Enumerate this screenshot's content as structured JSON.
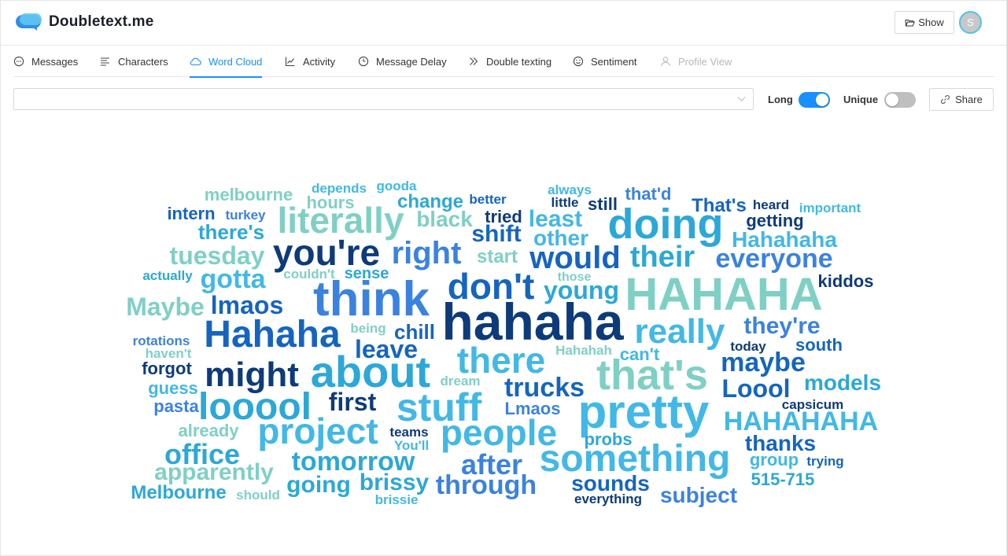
{
  "app": {
    "title": "Doubletext.me"
  },
  "header": {
    "show_label": "Show",
    "avatar_initial": "S"
  },
  "tabs": [
    {
      "label": "Messages",
      "icon": "message-circle-icon",
      "state": "normal"
    },
    {
      "label": "Characters",
      "icon": "text-align-left-icon",
      "state": "normal"
    },
    {
      "label": "Word Cloud",
      "icon": "cloud-icon",
      "state": "active"
    },
    {
      "label": "Activity",
      "icon": "line-chart-icon",
      "state": "normal"
    },
    {
      "label": "Message Delay",
      "icon": "clock-icon",
      "state": "normal"
    },
    {
      "label": "Double texting",
      "icon": "double-chevron-right-icon",
      "state": "normal"
    },
    {
      "label": "Sentiment",
      "icon": "smile-icon",
      "state": "normal"
    },
    {
      "label": "Profile View",
      "icon": "user-icon",
      "state": "disabled"
    }
  ],
  "toolbar": {
    "select_value": "",
    "long_label": "Long",
    "long_enabled": true,
    "unique_label": "Unique",
    "unique_enabled": false,
    "share_label": "Share"
  },
  "colors": {
    "accent": "#1890ff",
    "palette": [
      "#0d3b7a",
      "#1565c0",
      "#3b82e0",
      "#42b8e6",
      "#7fd0c4",
      "#2ba8d8"
    ]
  },
  "word_cloud": [
    {
      "text": "hahaha"
    },
    {
      "text": "think"
    },
    {
      "text": "HAHAHA"
    },
    {
      "text": "pretty"
    },
    {
      "text": "about"
    },
    {
      "text": "that's"
    },
    {
      "text": "something"
    },
    {
      "text": "doing"
    },
    {
      "text": "Hahaha"
    },
    {
      "text": "people"
    },
    {
      "text": "don't"
    },
    {
      "text": "stuff"
    },
    {
      "text": "project"
    },
    {
      "text": "literally"
    },
    {
      "text": "there"
    },
    {
      "text": "really"
    },
    {
      "text": "looool"
    },
    {
      "text": "you're"
    },
    {
      "text": "might"
    },
    {
      "text": "right"
    },
    {
      "text": "would"
    },
    {
      "text": "their"
    },
    {
      "text": "everyone"
    },
    {
      "text": "tomorrow"
    },
    {
      "text": "through"
    },
    {
      "text": "office"
    },
    {
      "text": "after"
    },
    {
      "text": "trucks"
    },
    {
      "text": "maybe"
    },
    {
      "text": "HAHAHAHA"
    },
    {
      "text": "young"
    },
    {
      "text": "lmaos"
    },
    {
      "text": "Maybe"
    },
    {
      "text": "gotta"
    },
    {
      "text": "they're"
    },
    {
      "text": "tuesday"
    },
    {
      "text": "apparently"
    },
    {
      "text": "Loool"
    },
    {
      "text": "models"
    },
    {
      "text": "brissy"
    },
    {
      "text": "leave"
    },
    {
      "text": "first"
    },
    {
      "text": "going"
    },
    {
      "text": "sounds"
    },
    {
      "text": "subject"
    },
    {
      "text": "thanks"
    },
    {
      "text": "Hahahaha"
    },
    {
      "text": "shift"
    },
    {
      "text": "least"
    },
    {
      "text": "other"
    },
    {
      "text": "black"
    },
    {
      "text": "there's"
    },
    {
      "text": "melbourne"
    },
    {
      "text": "Melbourne"
    },
    {
      "text": "chill"
    },
    {
      "text": "That's"
    },
    {
      "text": "getting"
    },
    {
      "text": "change"
    },
    {
      "text": "start"
    },
    {
      "text": "hours"
    },
    {
      "text": "intern"
    },
    {
      "text": "kiddos"
    },
    {
      "text": "forgot"
    },
    {
      "text": "guess"
    },
    {
      "text": "pasta"
    },
    {
      "text": "already"
    },
    {
      "text": "group"
    },
    {
      "text": "515-715"
    },
    {
      "text": "south"
    },
    {
      "text": "probs"
    },
    {
      "text": "Lmaos"
    },
    {
      "text": "sense"
    },
    {
      "text": "still"
    },
    {
      "text": "that'd"
    },
    {
      "text": "tried"
    },
    {
      "text": "can't"
    },
    {
      "text": "important"
    },
    {
      "text": "heard"
    },
    {
      "text": "turkey"
    },
    {
      "text": "depends"
    },
    {
      "text": "gooda"
    },
    {
      "text": "always"
    },
    {
      "text": "better"
    },
    {
      "text": "little"
    },
    {
      "text": "actually"
    },
    {
      "text": "couldn't"
    },
    {
      "text": "those"
    },
    {
      "text": "rotations"
    },
    {
      "text": "haven't"
    },
    {
      "text": "being"
    },
    {
      "text": "Hahahah"
    },
    {
      "text": "today"
    },
    {
      "text": "dream"
    },
    {
      "text": "capsicum"
    },
    {
      "text": "teams"
    },
    {
      "text": "You'll"
    },
    {
      "text": "trying"
    },
    {
      "text": "everything"
    },
    {
      "text": "should"
    },
    {
      "text": "brissie"
    }
  ]
}
